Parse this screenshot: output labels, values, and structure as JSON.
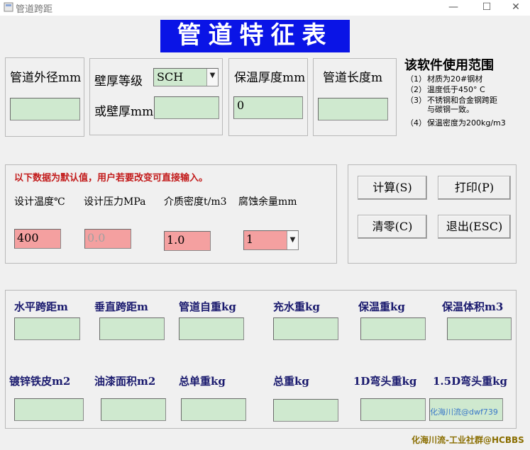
{
  "window": {
    "title": "管道跨距",
    "controls": {
      "minimize": "—",
      "maximize": "☐",
      "close": "✕"
    }
  },
  "banner": "管道特征表",
  "inputs": {
    "outer_diameter": {
      "label": "管道外径mm",
      "value": ""
    },
    "wall_grade": {
      "label": "壁厚等级",
      "value": "SCH"
    },
    "wall_thickness": {
      "label": "或壁厚mm",
      "value": ""
    },
    "insulation_thickness": {
      "label": "保温厚度mm",
      "value": "0"
    },
    "pipe_length": {
      "label": "管道长度m",
      "value": ""
    }
  },
  "scope": {
    "title": "该软件使用范围",
    "items": [
      {
        "num": "（1）",
        "text": "材质为20#钢材"
      },
      {
        "num": "（2）",
        "text": "温度低于450° C"
      },
      {
        "num": "（3）",
        "text": "不锈钢和合金钢跨距"
      },
      {
        "num": "",
        "text": "与碳钢一致。"
      },
      {
        "num": "（4）",
        "text": "保温密度为200kg/m3"
      }
    ]
  },
  "defaults": {
    "notice": "以下数据为默认值，用户若要改变可直接输入。",
    "design_temp": {
      "label": "设计温度℃",
      "value": "400"
    },
    "design_pressure": {
      "label": "设计压力MPa",
      "value": "0.0"
    },
    "medium_density": {
      "label": "介质密度t/m3",
      "value": "1.0"
    },
    "corrosion_allowance": {
      "label": "腐蚀余量mm",
      "value": "1"
    }
  },
  "buttons": {
    "calculate": "计算(S)",
    "print": "打印(P)",
    "clear": "清零(C)",
    "exit": "退出(ESC)"
  },
  "results_row1": [
    {
      "label": "水平跨距m",
      "value": ""
    },
    {
      "label": "垂直跨距m",
      "value": ""
    },
    {
      "label": "管道自重kg",
      "value": ""
    },
    {
      "label": "充水重kg",
      "value": ""
    },
    {
      "label": "保温重kg",
      "value": ""
    },
    {
      "label": "保温体积m3",
      "value": ""
    }
  ],
  "results_row2": [
    {
      "label": "镀锌铁皮m2",
      "value": ""
    },
    {
      "label": "油漆面积m2",
      "value": ""
    },
    {
      "label": "总单重kg",
      "value": ""
    },
    {
      "label": "总重kg",
      "value": ""
    },
    {
      "label": "1D弯头重kg",
      "value": ""
    },
    {
      "label": "1.5D弯头重kg",
      "value": ""
    }
  ],
  "watermarks": {
    "mark1": "化海川流@dwf739",
    "mark2": "化海川流-工业社群@HCBBS"
  },
  "colors": {
    "banner_bg": "#0a14e6",
    "input_green": "#cfe9cf",
    "input_red": "#f4a0a0",
    "notice_red": "#c21a1a"
  }
}
